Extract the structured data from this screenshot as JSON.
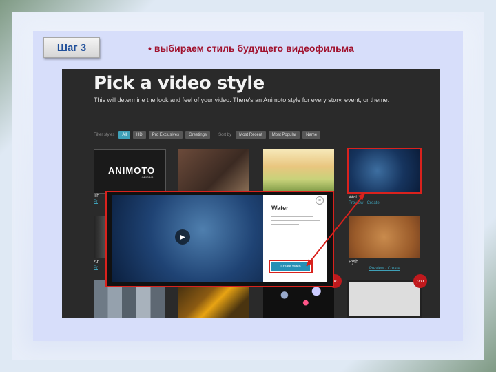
{
  "slide": {
    "step_label": "Шаг 3",
    "bullet": "•",
    "instruction": "выбираем стиль будущего видеофильма"
  },
  "screenshot": {
    "title": "Pick a video style",
    "subtitle": "This will determine the look and feel of your video. There's an Animoto style for every story, event, or theme.",
    "filter_label": "Filter styles",
    "filters": [
      "All",
      "HD",
      "Pro Exclusives",
      "Greetings"
    ],
    "sort_label": "Sort by",
    "sorts": [
      "Most Recent",
      "Most Popular",
      "Name"
    ],
    "tiles": [
      {
        "caption": "Th",
        "link": "Pr"
      },
      {
        "caption": "",
        "link": ""
      },
      {
        "caption": "",
        "link": ""
      },
      {
        "caption": "Wat",
        "link": "Preview · Create"
      },
      {
        "caption": "Ar",
        "link": "Pr"
      },
      {
        "caption": "Pyth",
        "link": "Preview · Create"
      }
    ],
    "animoto_logo": "ANIMOTO",
    "animoto_sub": "ORIGINAL",
    "pro_badge": "pro",
    "popup": {
      "title": "Water",
      "create_button": "Create Video",
      "close": "×",
      "play": "▶"
    }
  },
  "colors": {
    "highlight": "#d9221d",
    "accent": "#3fa1b8",
    "instruction_text": "#a1122e",
    "badge_text": "#1f4f9a"
  }
}
